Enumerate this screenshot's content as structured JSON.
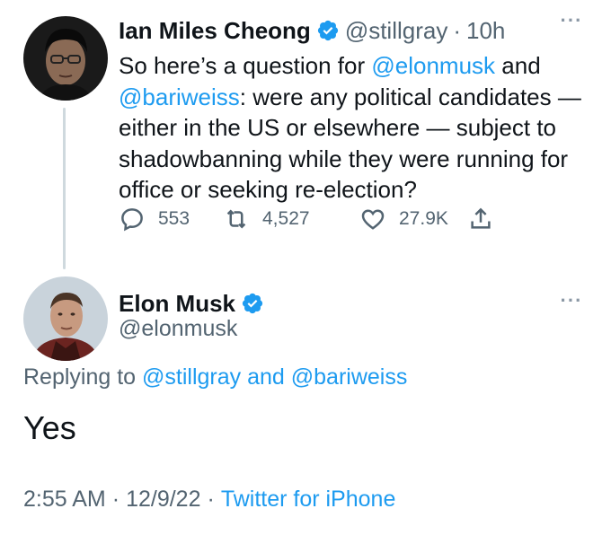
{
  "tweet1": {
    "author_name": "Ian Miles Cheong",
    "handle": "@stillgray",
    "separator": "·",
    "time": "10h",
    "text_lines": {
      "l1a": "So here’s a question for ",
      "l1b": "@elonmusk",
      "l1c": " and",
      "l2a": "@bariweiss",
      "l2b": ": were any political candidates —",
      "l3": "either in the US or elsewhere — subject to",
      "l4": "shadowbanning while they were running for",
      "l5": "office or seeking re-election?"
    },
    "more_label": "···",
    "actions": {
      "reply_count": "553",
      "retweet_count": "4,527",
      "like_count": "27.9K"
    }
  },
  "tweet2": {
    "author_name": "Elon Musk",
    "handle": "@elonmusk",
    "more_label": "···",
    "replying_prefix": "Replying to ",
    "replying_user1": "@stillgray",
    "replying_and": " and ",
    "replying_user2": "@bariweiss",
    "text": "Yes",
    "time": "2:55 AM",
    "separator": "·",
    "date": "12/9/22",
    "source": "Twitter for iPhone"
  },
  "colors": {
    "link": "#1d9bf0",
    "muted": "#536471",
    "text": "#0f1419",
    "verified": "#1d9bf0",
    "thread_line": "#cfd9de"
  },
  "icons": [
    "reply-icon",
    "retweet-icon",
    "like-icon",
    "share-icon",
    "verified-badge-icon",
    "more-options-icon"
  ]
}
